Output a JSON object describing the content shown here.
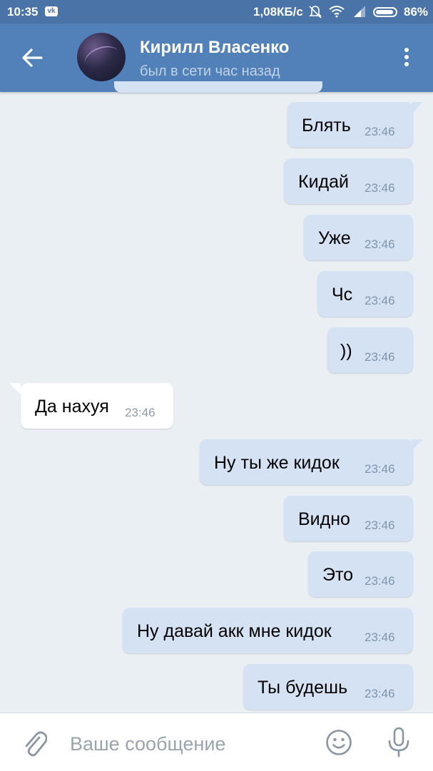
{
  "status_bar": {
    "time": "10:35",
    "vk_badge": "vk",
    "net_speed": "1,08КБ/с",
    "battery_percent": "86%",
    "icons": [
      "vk-icon",
      "mute-icon",
      "wifi-icon",
      "signal-icon",
      "battery-icon"
    ]
  },
  "header": {
    "contact_name": "Кирилл Власенко",
    "last_seen": "был в сети час назад",
    "icons": [
      "back-arrow-icon",
      "more-vert-icon"
    ]
  },
  "messages": [
    {
      "text": "Блять",
      "time": "23:46",
      "direction": "out"
    },
    {
      "text": "Кидай",
      "time": "23:46",
      "direction": "out"
    },
    {
      "text": "Уже",
      "time": "23:46",
      "direction": "out"
    },
    {
      "text": "Чс",
      "time": "23:46",
      "direction": "out"
    },
    {
      "text": "))",
      "time": "23:46",
      "direction": "out"
    },
    {
      "text": "Да нахуя",
      "time": "23:46",
      "direction": "in"
    },
    {
      "text": "Ну ты же кидок",
      "time": "23:46",
      "direction": "out"
    },
    {
      "text": "Видно",
      "time": "23:46",
      "direction": "out"
    },
    {
      "text": "Это",
      "time": "23:46",
      "direction": "out"
    },
    {
      "text": "Ну давай акк мне кидок",
      "time": "23:46",
      "direction": "out"
    },
    {
      "text": "Ты будешь",
      "time": "23:46",
      "direction": "out"
    }
  ],
  "composer": {
    "placeholder": "Ваше сообщение",
    "value": "",
    "icons": [
      "attach-icon",
      "smile-icon",
      "mic-icon"
    ]
  },
  "colors": {
    "header": "#5181b8",
    "status_bar": "#4a73a8",
    "background": "#eaeff4",
    "outgoing_bubble": "#d4e2f4",
    "incoming_bubble": "#ffffff"
  }
}
